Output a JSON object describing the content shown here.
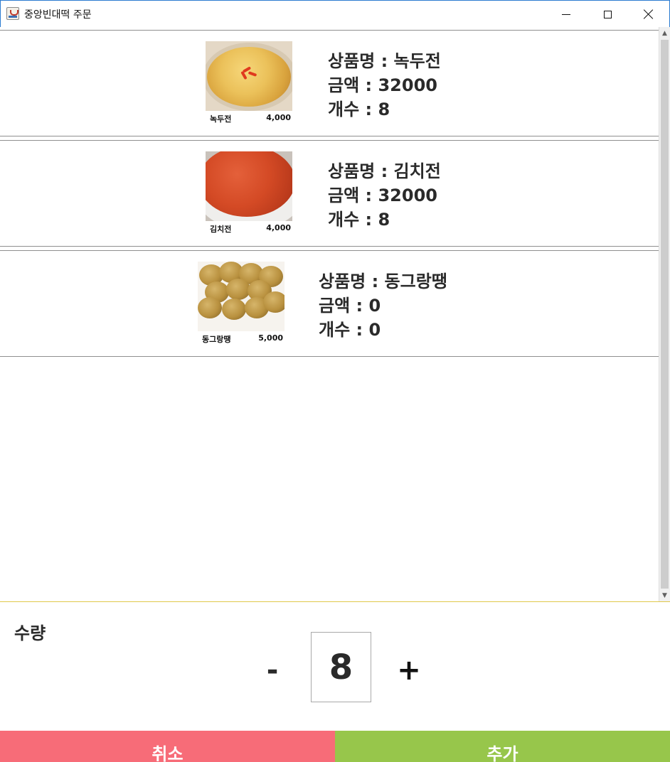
{
  "window": {
    "title": "중앙빈대떡 주문",
    "icon": "java-cup-icon"
  },
  "items": [
    {
      "thumb_name": "녹두전",
      "thumb_price": "4,000",
      "product_line": "상품명 : 녹두전",
      "amount_line": "금액 : 32000",
      "count_line": "개수 : 8"
    },
    {
      "thumb_name": "김치전",
      "thumb_price": "4,000",
      "product_line": "상품명 : 김치전",
      "amount_line": "금액 : 32000",
      "count_line": "개수 : 8"
    },
    {
      "thumb_name": "동그랑땡",
      "thumb_price": "5,000",
      "product_line": "상품명 : 동그랑땡",
      "amount_line": "금액 : 0",
      "count_line": "개수 : 0"
    }
  ],
  "quantity": {
    "label": "수량",
    "minus": "-",
    "value": "8",
    "plus": "+"
  },
  "actions": {
    "cancel": "취소",
    "add": "추가"
  },
  "colors": {
    "cancel_bg": "#f76c78",
    "add_bg": "#97c64b"
  }
}
